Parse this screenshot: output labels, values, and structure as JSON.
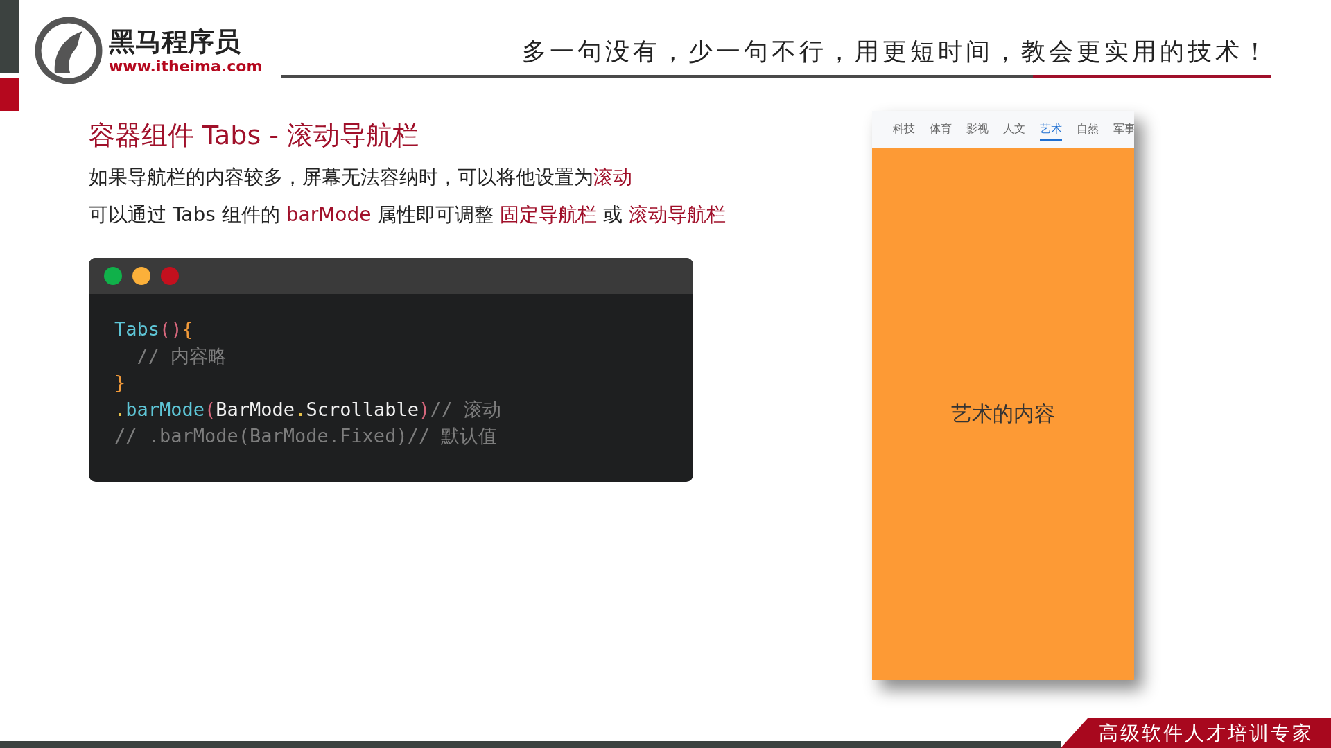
{
  "header": {
    "brand": "黑马程序员",
    "url": "www.itheima.com",
    "slogan": "多一句没有，少一句不行，用更短时间，教会更实用的技术！"
  },
  "title": "容器组件 Tabs - 滚动导航栏",
  "paragraphs": [
    [
      {
        "text": "如果导航栏的内容较多，屏幕无法容纳时，可以将他设置为",
        "highlight": false
      },
      {
        "text": "滚动",
        "highlight": true
      }
    ],
    [
      {
        "text": "可以通过 Tabs 组件的 ",
        "highlight": false
      },
      {
        "text": "barMode",
        "highlight": true
      },
      {
        "text": " 属性即可调整 ",
        "highlight": false
      },
      {
        "text": "固定导航栏",
        "highlight": true
      },
      {
        "text": " 或 ",
        "highlight": false
      },
      {
        "text": "滚动导航栏",
        "highlight": true
      }
    ]
  ],
  "code_window": {
    "lines": [
      [
        {
          "text": "Tabs",
          "kind": "fn"
        },
        {
          "text": "()",
          "kind": "paren"
        },
        {
          "text": "{",
          "kind": "brace"
        }
      ],
      [
        {
          "text": "  // 内容略",
          "kind": "comment"
        }
      ],
      [
        {
          "text": "}",
          "kind": "brace"
        }
      ],
      [
        {
          "text": ".",
          "kind": "dot"
        },
        {
          "text": "barMode",
          "kind": "fn"
        },
        {
          "text": "(",
          "kind": "paren"
        },
        {
          "text": "BarMode",
          "kind": "plain"
        },
        {
          "text": ".",
          "kind": "dot"
        },
        {
          "text": "Scrollable",
          "kind": "plain"
        },
        {
          "text": ")",
          "kind": "paren"
        },
        {
          "text": "// 滚动",
          "kind": "comment"
        }
      ],
      [
        {
          "text": "// .barMode(BarMode.Fixed)// 默认值",
          "kind": "comment"
        }
      ]
    ]
  },
  "phone": {
    "tabs": [
      {
        "label": "科技",
        "selected": false
      },
      {
        "label": "体育",
        "selected": false
      },
      {
        "label": "影视",
        "selected": false
      },
      {
        "label": "人文",
        "selected": false
      },
      {
        "label": "艺术",
        "selected": true
      },
      {
        "label": "自然",
        "selected": false
      },
      {
        "label": "军事",
        "selected": false
      }
    ],
    "content": "艺术的内容"
  },
  "footer": {
    "banner": "高级软件人才培训专家"
  }
}
